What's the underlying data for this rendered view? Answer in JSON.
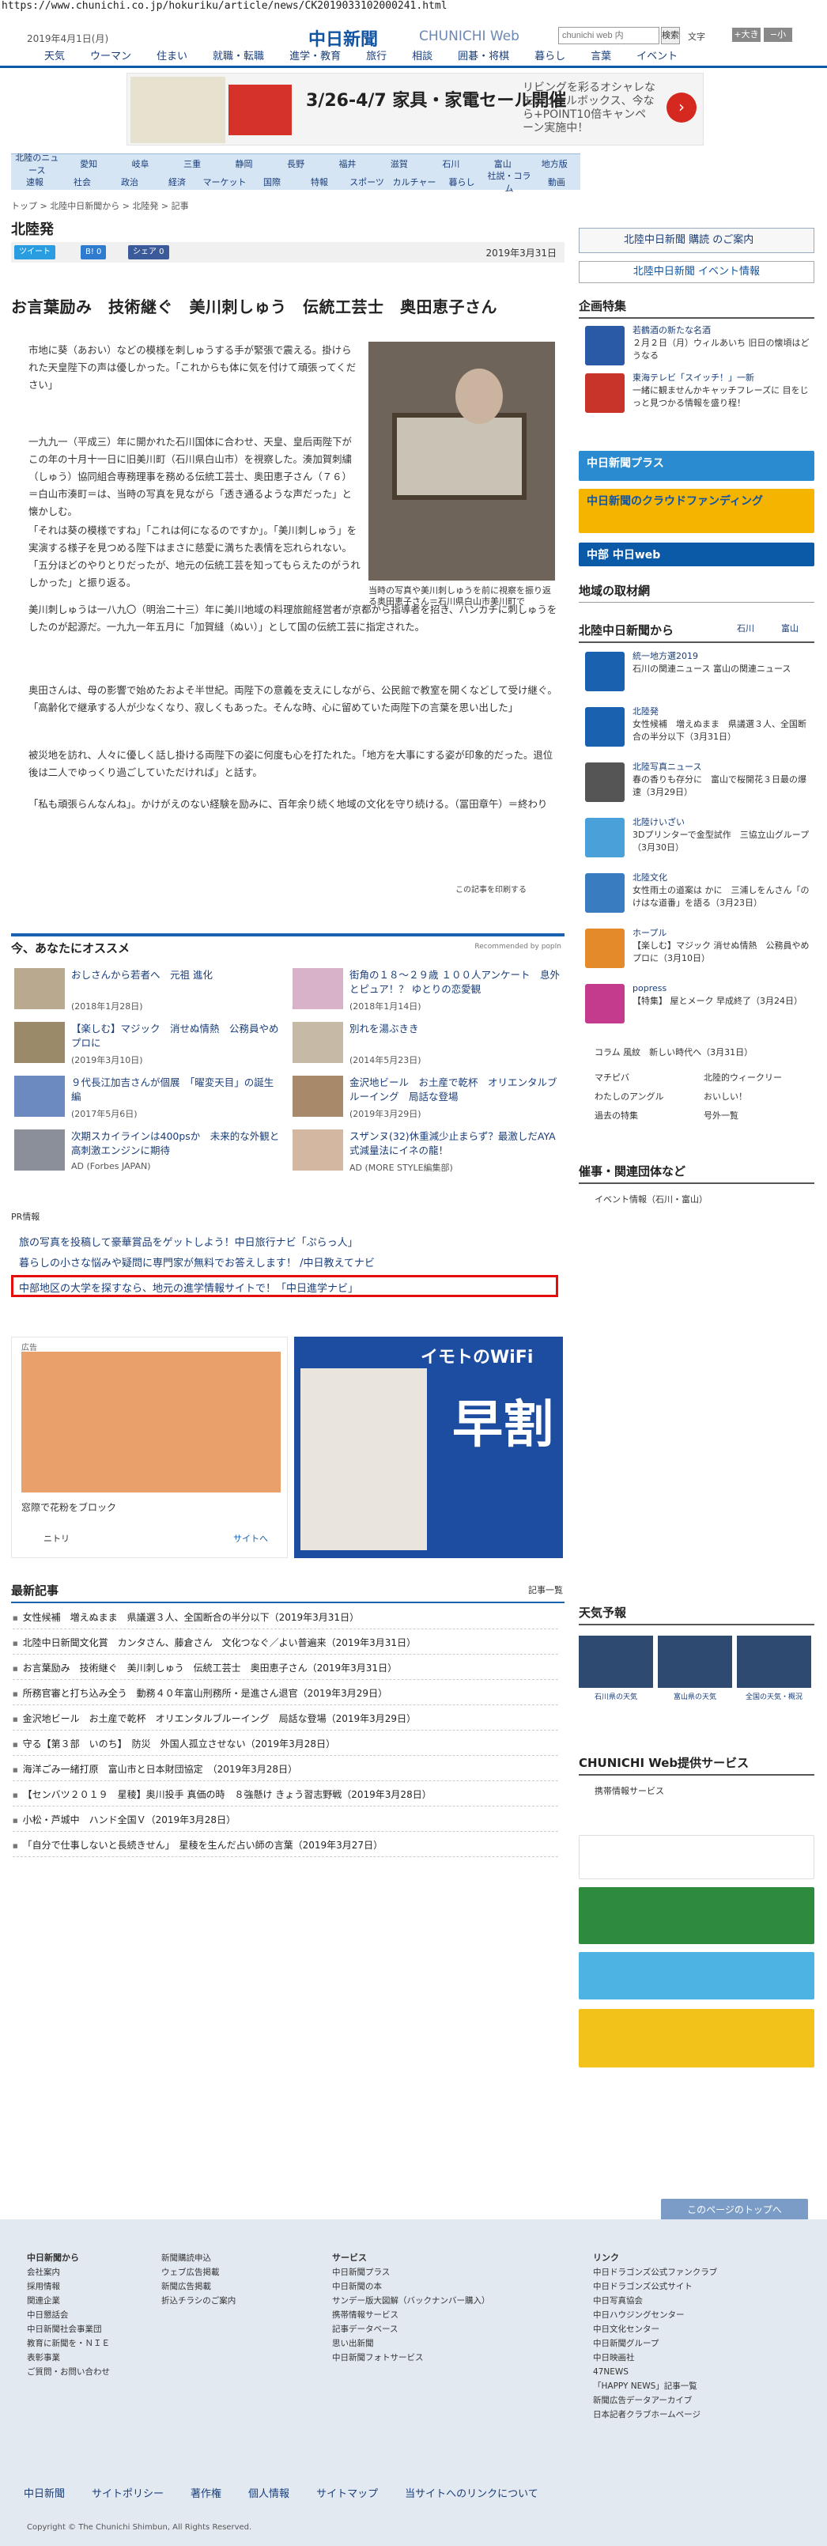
{
  "url": "https://www.chunichi.co.jp/hokuriku/article/news/CK2019033102000241.html",
  "header": {
    "date": "2019年4月1日(月)",
    "logo": "中日新聞",
    "logo_sub": "CHUNICHI Web",
    "search_placeholder": "chunichi web 内",
    "search_btn": "検索",
    "font_label": "文字",
    "font_large": "+大きく",
    "font_small": "−小"
  },
  "gnav": [
    "天気",
    "ウーマン",
    "住まい",
    "就職・転職",
    "進学・教育",
    "旅行",
    "相談",
    "囲碁・将棋",
    "暮らし",
    "言葉",
    "イベント"
  ],
  "ad_top": {
    "title": "3/26-4/7 家具・家電セール開催",
    "desc": "リビングを彩るオシャレなモジュールボックス、今なら+POINT10倍キャンペーン実施中！"
  },
  "subnav": {
    "row1": [
      "北陸のニュース",
      "愛知",
      "岐阜",
      "三重",
      "静岡",
      "長野",
      "福井",
      "滋賀",
      "石川",
      "富山",
      "地方版"
    ],
    "row2": [
      "速報",
      "社会",
      "政治",
      "経済",
      "マーケット",
      "国際",
      "特報",
      "スポーツ",
      "カルチャー",
      "暮らし",
      "社説・コラム",
      "動画"
    ]
  },
  "breadcrumb": "トップ > 北陸中日新聞から > 北陸発 > 記事",
  "page_title": "北陸発",
  "share": {
    "tweet": "ツイート",
    "hb": "B! 0",
    "fb": "シェア 0",
    "date": "2019年3月31日"
  },
  "article": {
    "headline": "お言葉励み　技術継ぐ　美川刺しゅう　伝統工芸士　奥田恵子さん",
    "caption": "当時の写真や美川刺しゅうを前に視察を振り返る奥田恵子さん＝石川県白山市美川町で",
    "p": [
      "市地に葵（あおい）などの模様を刺しゅうする手が緊張で震える。掛けられた天皇陛下の声は優しかった。「これからも体に気を付けて頑張ってください」",
      "一九九一（平成三）年に開かれた石川国体に合わせ、天皇、皇后両陛下がこの年の十月十一日に旧美川町（石川県白山市）を視察した。湊加賀刺繍（しゅう）協同組合専務理事を務める伝統工芸士、奥田恵子さん（７６）＝白山市湊町＝は、当時の写真を見ながら「透き通るような声だった」と懐かしむ。",
      "「それは葵の模様ですね」「これは何になるのですか」。「美川刺しゅう」を実演する様子を見つめる陛下はまさに慈愛に満ちた表情を忘れられない。「五分ほどのやりとりだったが、地元の伝統工芸を知ってもらえたのがうれしかった」と振り返る。",
      "美川刺しゅうは一八九〇（明治二十三）年に美川地域の料理旅館経営者が京都から指導者を招き、ハンカチに刺しゅうをしたのが起源だ。一九九一年五月に「加賀縫（ぬい）」として国の伝統工芸に指定された。",
      "奥田さんは、母の影響で始めたおよそ半世紀。両陛下の意義を支えにしながら、公民館で教室を開くなどして受け継ぐ。「高齢化で継承する人が少なくなり、寂しくもあった。そんな時、心に留めていた両陛下の言葉を思い出した」",
      "被災地を訪れ、人々に優しく話し掛ける両陛下の姿に何度も心を打たれた。「地方を大事にする姿が印象的だった。退位後は二人でゆっくり過ごしていただければ」と話す。",
      "「私も頑張らんなんね」。かけがえのない経験を励みに、百年余り続く地域の文化を守り続ける。（冨田章午）＝終わり"
    ],
    "print": "この記事を印刷する"
  },
  "recommend": {
    "title": "今、あなたにオススメ",
    "by": "Recommended by popIn",
    "items": [
      {
        "t": "おしさんから若者へ　元祖 進化",
        "d": "(2018年1月28日)"
      },
      {
        "t": "街角の１８～２９歳 １００人アンケート　息外とピュア！？ ゆとりの恋愛観",
        "d": "(2018年1月14日)"
      },
      {
        "t": "【楽しむ】マジック　消せぬ情熱　公務員やめプロに",
        "d": "(2019年3月10日)"
      },
      {
        "t": "別れを湯ぶきき",
        "d": "(2014年5月23日)"
      },
      {
        "t": "９代長江加吉さんが個展　「曜変天目」の誕生編",
        "d": "(2017年5月6日)"
      },
      {
        "t": "金沢地ビール　お土産で乾杯　オリエンタルブルーイング　局話な登場",
        "d": "(2019年3月29日)"
      },
      {
        "t": "次期スカイラインは400psか　未来的な外観と高刺激エンジンに期待",
        "d": "AD (Forbes JAPAN)"
      },
      {
        "t": "スザンヌ(32)休重減少止まらず？最激しだAYA式減量法にイネの龍！",
        "d": "AD (MORE STYLE編集部)"
      }
    ]
  },
  "pr": {
    "label": "PR情報",
    "links": [
      "旅の写真を投稿して豪華賞品をゲットしよう！中日旅行ナビ「ぷらっ人」",
      "暮らしの小さな悩みや疑問に専門家が無料でお答えします！ /中日教えてナビ",
      "中部地区の大学を探すなら、地元の進学情報サイトで！「中日進学ナビ」"
    ]
  },
  "ads2": {
    "label": "広告",
    "cap": "窓際で花粉をブロック",
    "brand": "ニトリ",
    "site": "サイトへ",
    "wifi": "イモトのWiFi",
    "early": "早割"
  },
  "news": {
    "title": "最新記事",
    "more": "記事一覧",
    "items": [
      "女性候補　増えぬまま　県議選３人、全国断合の半分以下（2019年3月31日）",
      "北陸中日新聞文化賞　カンタさん、藤倉さん　文化つなぐ／よい普遍来（2019年3月31日）",
      "お言葉励み　技術継ぐ　美川刺しゅう　伝統工芸士　奥田恵子さん（2019年3月31日）",
      "所務官審と打ち込み全う　動務４０年富山刑務所・是進さん退官（2019年3月29日）",
      "金沢地ビール　お土産で乾杯　オリエンタルブルーイング　局話な登場（2019年3月29日）",
      "守る【第３部　いのち】　防災　外国人孤立させない（2019年3月28日）",
      "海洋ごみ一緒打原　富山市と日本財団協定　（2019年3月28日）",
      "【センバツ２０１９　星稜】奥川投手 真価の時　８強懸け きょう習志野戦（2019年3月28日）",
      "小松・芦城中　ハンド全国Ｖ（2019年3月28日）",
      "「自分で仕事しないと長続きせん」　星稜を生んだ占い師の言葉（2019年3月27日）"
    ]
  },
  "right": {
    "subscribe": "北陸中日新聞 購読 のご案内",
    "event": "北陸中日新聞 イベント情報",
    "kikaku": "企画特集",
    "k": [
      {
        "b": "若鶴酒の新たな名酒",
        "d": "２月２日（月）ウィルあいち 旧日の懐頃はどうなる"
      },
      {
        "b": "東海テレビ「スイッチ！」一新",
        "d": "一緒に観ませんかキャッチフレーズに 目をじっと見つかる情報を盛り程！"
      }
    ],
    "plus": "中日新聞プラス",
    "cf": "中日新聞のクラウドファンディング",
    "web": "中部 中日web",
    "local": "地域の取材網",
    "fromh": "北陸中日新聞から",
    "tabs": [
      "石川",
      "富山"
    ],
    "f": [
      {
        "b": "統一地方選2019",
        "d": "石川の関連ニュース 富山の関連ニュース"
      },
      {
        "b": "北陸発",
        "d": "女性候補　増えぬまま　県議選３人、全国断合の半分以下（3月31日）"
      },
      {
        "b": "北陸写真ニュース",
        "d": "春の香りも存分に　富山で桜開花３日最の爆速（3月29日）"
      },
      {
        "b": "北陸けいざい",
        "d": "3Dプリンターで金型試作　三協立山グループ（3月30日）"
      },
      {
        "b": "北陸文化",
        "d": "女性雨土の道案は かに　三浦しをんさん「のけはな道番」を語る（3月23日）"
      },
      {
        "b": "ホープル",
        "d": "【楽しむ】マジック 消せぬ情熱　公務員やめプロに（3月10日）"
      },
      {
        "b": "popress",
        "d": "【特集】 屋とメーク 早成終了（3月24日）"
      }
    ],
    "column": "コラム 風紋　新しい時代へ（3月31日）",
    "links": [
      "マチピバ",
      "北陸的ウィークリー",
      "わたしのアングル",
      "おいしい！",
      "過去の特集",
      "号外一覧"
    ],
    "kanren": "催事・関連団体など",
    "events": "イベント情報（石川・富山）",
    "weather": "天気予報",
    "wx": [
      "石川県の天気",
      "富山県の天気",
      "全国の天気・概況"
    ],
    "svc": "CHUNICHI Web提供サービス",
    "keitai": "携帯情報サービス"
  },
  "footer": {
    "c1": [
      "中日新聞から",
      "会社案内",
      "採用情報",
      "関連企業",
      "中日懇話会",
      "中日新聞社会事業団",
      "教育に新聞を・ＮＩＥ",
      "表彰事業",
      "ご質問・お問い合わせ"
    ],
    "c2": [
      "新聞購読申込",
      "ウェブ広告掲載",
      "新聞広告掲載",
      "折込チラシのご案内"
    ],
    "c3": [
      "サービス",
      "中日新聞プラス",
      "中日新聞の本",
      "サンデー版大図解（バックナンバー購入）",
      "携帯情報サービス",
      "記事データベース",
      "思い出新聞",
      "中日新聞フォトサービス"
    ],
    "c4": [
      "リンク",
      "中日ドラゴンズ公式ファンクラブ",
      "中日ドラゴンズ公式サイト",
      "中日写真協会",
      "中日ハウジングセンター",
      "中日文化センター",
      "中日新聞グループ",
      "中日映画社",
      "47NEWS",
      "「HAPPY NEWS」記事一覧",
      "新聞広告データアーカイブ",
      "日本記者クラブホームページ"
    ],
    "nav": [
      "中日新聞",
      "サイトポリシー",
      "著作権",
      "個人情報",
      "サイトマップ",
      "当サイトへのリンクについて"
    ],
    "copy": "Copyright © The Chunichi Shimbun, All Rights Reserved.",
    "top": "このページのトップへ"
  }
}
